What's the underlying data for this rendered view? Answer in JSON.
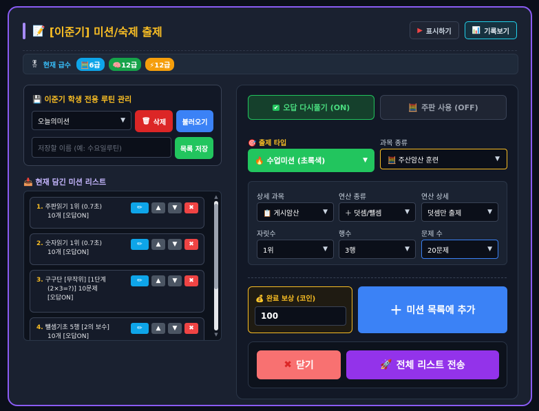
{
  "header": {
    "title": "[이준기] 미션/숙제 출제",
    "title_icon": "📝",
    "show_btn": "표시하기",
    "record_btn": "기록보기",
    "record_icon": "📊"
  },
  "grade": {
    "label": "현재 급수",
    "label_icon": "🎖",
    "badges": [
      {
        "icon": "🧮",
        "text": "6급",
        "color": "#0ea5e9"
      },
      {
        "icon": "🧠",
        "text": "12급",
        "color": "#16a34a"
      },
      {
        "icon": "⚡",
        "text": "12급",
        "color": "#f59e0b"
      }
    ]
  },
  "routine": {
    "title": "이준기 학생 전용 루틴 관리",
    "title_icon": "💾",
    "selected": "오늘의미션",
    "delete_btn": "삭제",
    "delete_icon": "🗑",
    "load_btn": "불러오기",
    "save_placeholder": "저장할 이름 (예: 수요일루틴)",
    "save_btn": "목록 저장"
  },
  "list": {
    "title": "현재 담긴 미션 리스트",
    "title_icon": "📥",
    "items": [
      {
        "num": "1.",
        "lines": [
          "주판읽기 1위 (0.7초)",
          "10개 [오답ON]"
        ]
      },
      {
        "num": "2.",
        "lines": [
          "숫자읽기 1위 (0.7초)",
          "10개 [오답ON]"
        ]
      },
      {
        "num": "3.",
        "lines": [
          "구구단 [무작위] [1단계",
          "(2×3=?)] 10문제",
          "[오답ON]"
        ]
      },
      {
        "num": "4.",
        "lines": [
          "뺄셈기초 5행 [2의 보수]",
          "10개 [오답ON]"
        ]
      }
    ]
  },
  "toggles": {
    "wrong_retry": "오답 다시풀기 (ON)",
    "abacus": "주판 사용 (OFF)",
    "abacus_icon": "🧮"
  },
  "type": {
    "label": "출제 타입",
    "label_icon": "🎯",
    "value": "수업미션 (초록색)",
    "value_icon": "🔥"
  },
  "subject": {
    "label": "과목 종류",
    "value": "주산암산 훈련",
    "icon": "🧮"
  },
  "details": {
    "subject_label": "상세 과목",
    "subject_value": "게시암산",
    "subject_icon": "📋",
    "op_label": "연산 종류",
    "op_value": "덧셈/뺄셈",
    "op_detail_label": "연산 상세",
    "op_detail_value": "덧셈만 출제",
    "digits_label": "자릿수",
    "digits_value": "1위",
    "rows_label": "행수",
    "rows_value": "3행",
    "count_label": "문제 수",
    "count_value": "20문제"
  },
  "reward": {
    "label": "완료 보상 (코인)",
    "label_icon": "💰",
    "value": "100"
  },
  "add_btn": "미션 목록에 추가",
  "close_btn": "닫기",
  "send_btn": "전체 리스트 전송",
  "send_icon": "🚀"
}
